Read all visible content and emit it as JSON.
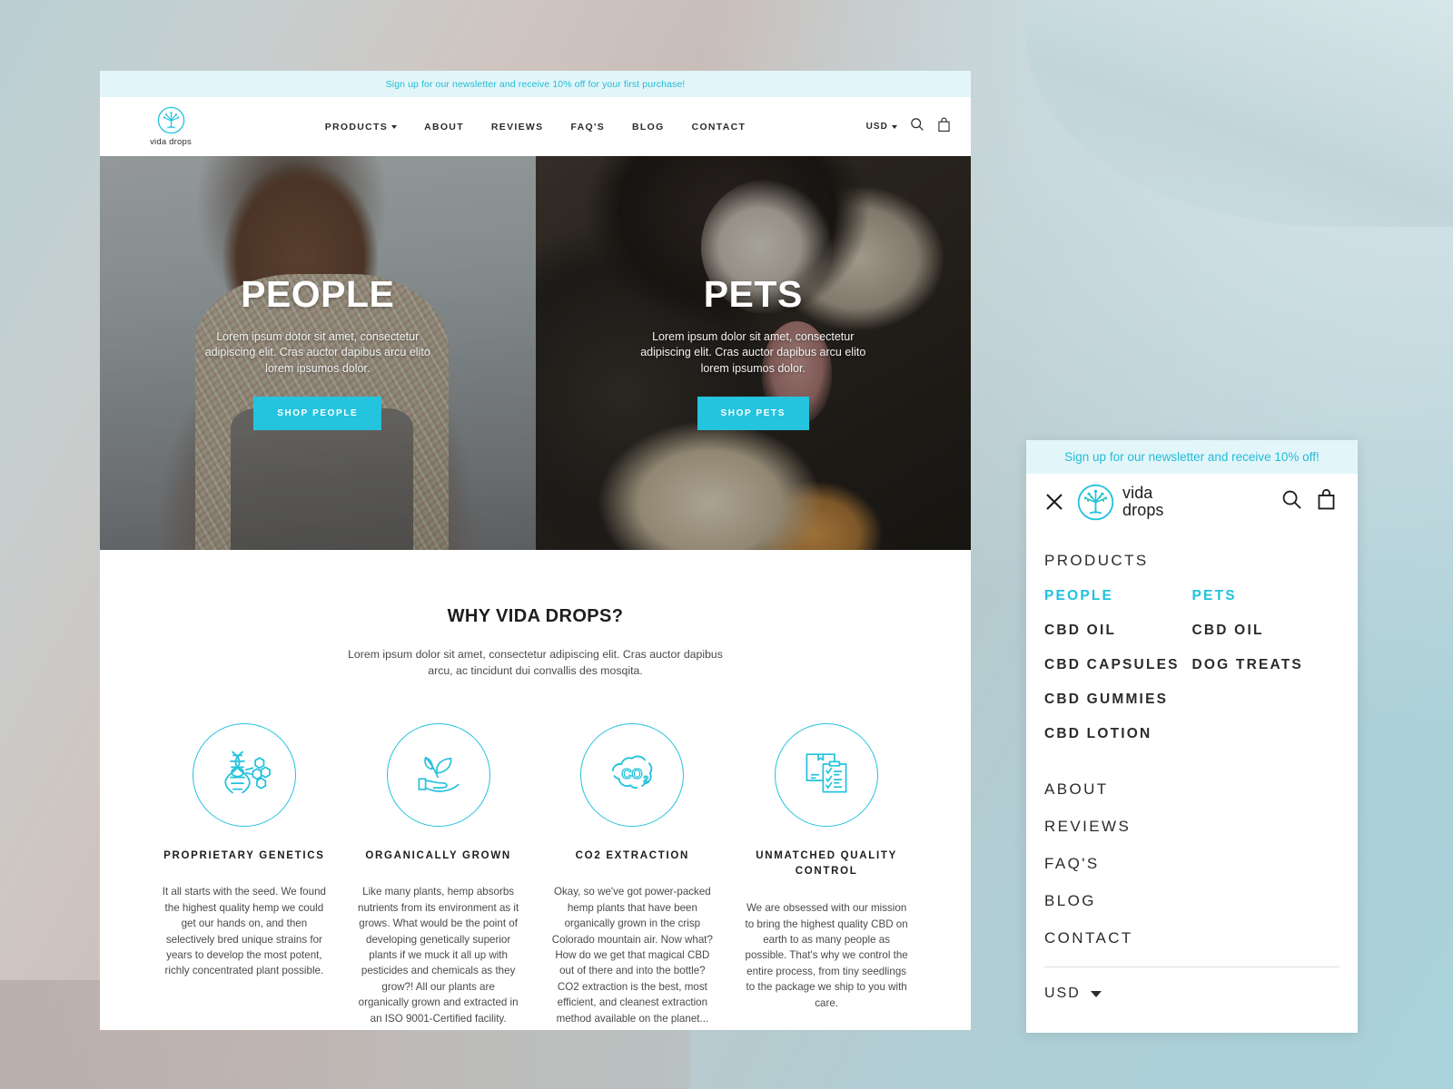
{
  "announcement": {
    "desktop_text": "Sign up for our newsletter and receive 10% off for your first purchase!",
    "mobile_text": "Sign up for our newsletter and receive 10% off!",
    "bg": "#e2f6f9",
    "color": "#21bcd8"
  },
  "brand": {
    "name": "vida drops",
    "logo_icon": "tree-circle-logo-icon",
    "mobile_line1": "vida",
    "mobile_line2": "drops",
    "accent": "#24c3de"
  },
  "header": {
    "nav": [
      {
        "label": "PRODUCTS",
        "has_dropdown": true
      },
      {
        "label": "ABOUT",
        "has_dropdown": false
      },
      {
        "label": "REVIEWS",
        "has_dropdown": false
      },
      {
        "label": "FAQ'S",
        "has_dropdown": false
      },
      {
        "label": "BLOG",
        "has_dropdown": false
      },
      {
        "label": "CONTACT",
        "has_dropdown": false
      }
    ],
    "currency": "USD",
    "search_icon": "search-icon",
    "cart_icon": "shopping-bag-icon"
  },
  "hero": {
    "panels": [
      {
        "title": "PEOPLE",
        "subtitle": "Lorem ipsum dotor sit amet, consectetur adipiscing elit. Cras auctor dapibus arcu elito lorem ipsumos dolor.",
        "button": "SHOP PEOPLE"
      },
      {
        "title": "PETS",
        "subtitle": "Lorem ipsum dolor sit amet, consectetur adipiscing elit. Cras auctor dapibus arcu elito lorem ipsumos dolor.",
        "button": "SHOP PETS"
      }
    ]
  },
  "why": {
    "title": "WHY VIDA DROPS?",
    "subtitle": "Lorem ipsum dolor sit amet, consectetur adipiscing elit. Cras auctor dapibus arcu, ac tincidunt dui convallis des mosqita.",
    "features": [
      {
        "icon": "dna-molecule-icon",
        "title": "PROPRIETARY GENETICS",
        "body": "It all starts with the seed. We found the highest quality hemp we could get our hands on, and then selectively bred unique strains for years to develop the most potent, richly concentrated plant possible."
      },
      {
        "icon": "hand-holding-plant-icon",
        "title": "ORGANICALLY GROWN",
        "body": "Like many plants, hemp absorbs nutrients from its environment as it grows. What would be the point of developing genetically superior plants if we muck it all up with pesticides and chemicals as they grow?! All our plants are organically grown and extracted in an ISO 9001-Certified facility."
      },
      {
        "icon": "co2-cloud-icon",
        "title": "CO2 EXTRACTION",
        "body": "Okay, so we've got power-packed hemp plants that have been organically grown in the crisp Colorado mountain air. Now what? How do we get that magical CBD out of there and into the bottle?  CO2 extraction is the best, most efficient, and cleanest extraction method available on the planet..."
      },
      {
        "icon": "box-clipboard-checklist-icon",
        "title": "UNMATCHED QUALITY CONTROL",
        "body": "We are obsessed with our mission to bring the highest quality CBD on earth to as many people as possible. That's why we control the entire process, from tiny seedlings to the package we ship to you with care."
      }
    ]
  },
  "mobile_menu": {
    "close_icon": "close-icon",
    "search_icon": "search-icon",
    "cart_icon": "shopping-bag-icon",
    "products_label": "PRODUCTS",
    "columns": [
      {
        "head": "PEOPLE",
        "items": [
          "CBD OIL",
          "CBD CAPSULES",
          "CBD GUMMIES",
          "CBD LOTION"
        ]
      },
      {
        "head": "PETS",
        "items": [
          "CBD OIL",
          "DOG TREATS"
        ]
      }
    ],
    "links": [
      "ABOUT",
      "REVIEWS",
      "FAQ'S",
      "BLOG",
      "CONTACT"
    ],
    "currency": "USD",
    "currency_icon": "chevron-down-icon"
  }
}
